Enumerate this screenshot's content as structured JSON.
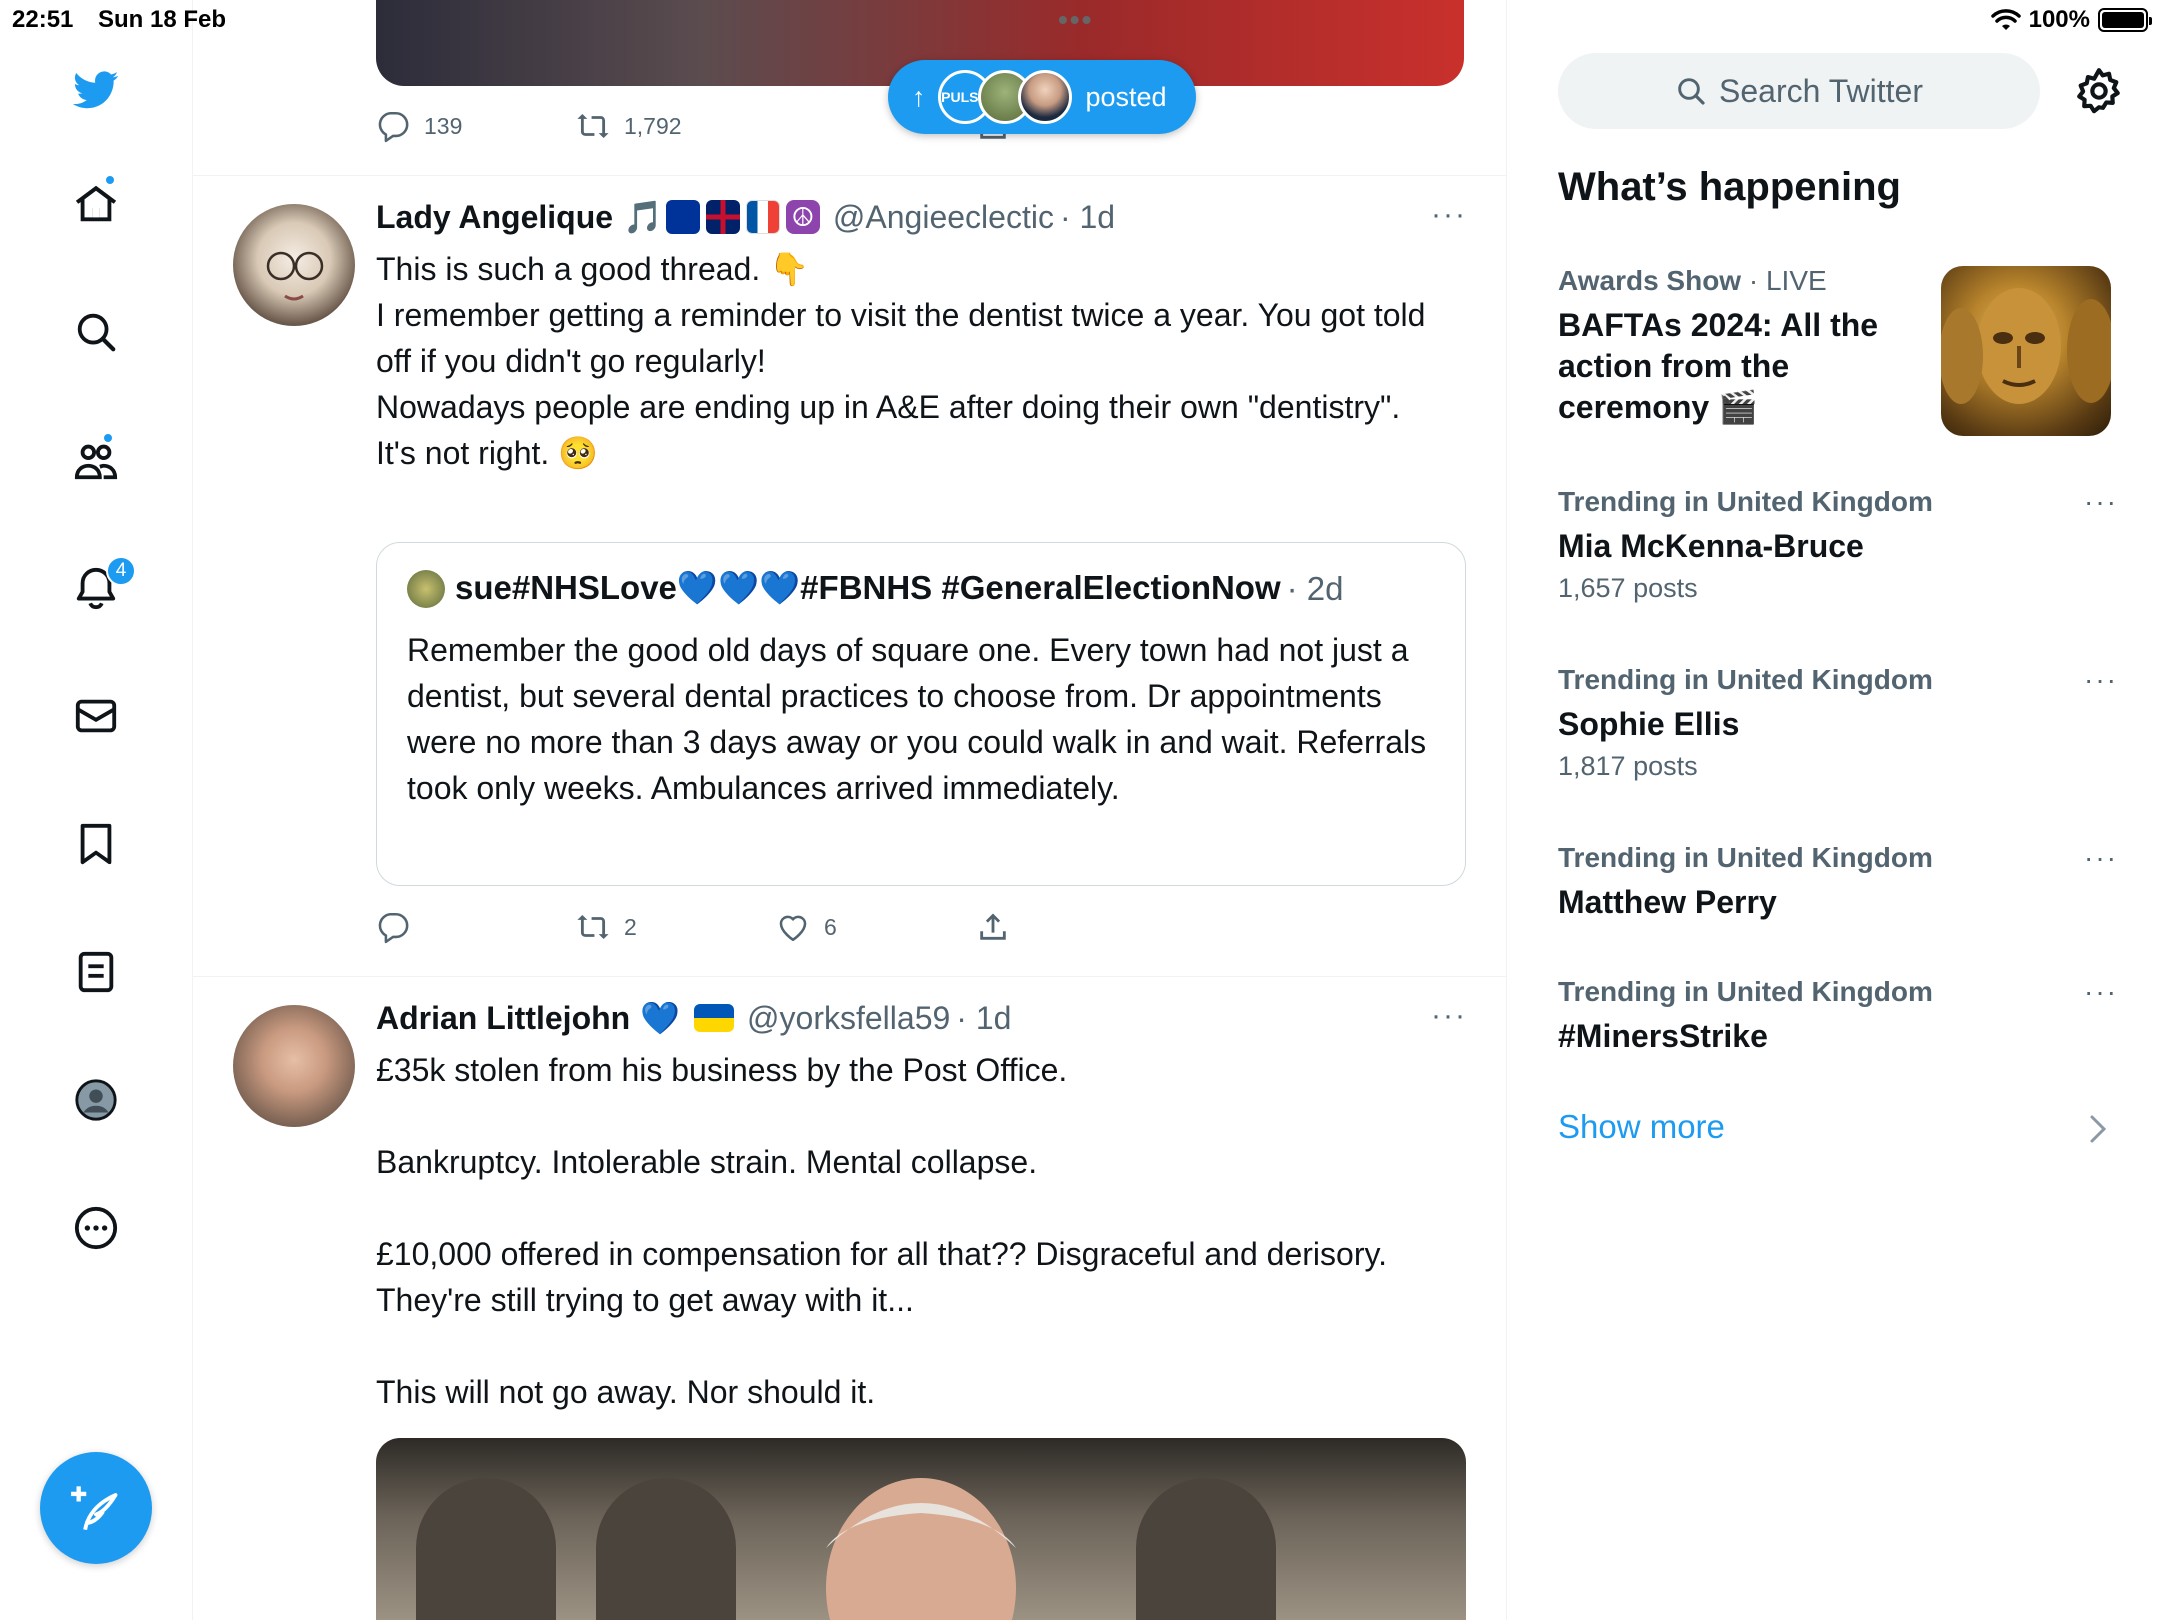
{
  "status_bar": {
    "time": "22:51",
    "date": "Sun 18 Feb",
    "battery": "100%",
    "dots": "•••"
  },
  "nav": {
    "notifications_badge": "4"
  },
  "top_tweet": {
    "replies": "139",
    "retweets": "1,792"
  },
  "new_posts_pill": {
    "label": "posted",
    "arrow": "↑",
    "avatar1_text": "PULSE"
  },
  "tweets": [
    {
      "name": "Lady Angelique",
      "name_suffix": "🎵",
      "handle": "@Angieeclectic",
      "time": "· 1d",
      "more": "···",
      "body": "This is such a good thread. 👇\nI remember getting a reminder to visit the dentist twice a year. You got told off if you didn't go regularly!\nNowadays people are ending up in A&E after doing their own \"dentistry\".\nIt's not right. 🥺",
      "quote": {
        "name": "sue#NHSLove💙💙💙#FBNHS #GeneralElectionNow",
        "time": "· 2d",
        "body": "Remember the good old days of square one. Every town had not just a dentist, but several dental practices to choose from. Dr appointments were no more than 3 days away or you could walk in and wait. Referrals took only weeks. Ambulances arrived immediately."
      },
      "retweets": "2",
      "likes": "6"
    },
    {
      "name": "Adrian Littlejohn",
      "name_suffix": "💙",
      "handle": "@yorksfella59",
      "time": "· 1d",
      "more": "···",
      "body": "£35k stolen from his business by the Post Office.\n\nBankruptcy. Intolerable strain. Mental collapse.\n\n£10,000 offered in compensation for all that?? Disgraceful and derisory. They're still trying to get away with it...\n\nThis will not go away. Nor should it."
    }
  ],
  "sidebar": {
    "search_placeholder": "Search Twitter",
    "heading": "What’s happening",
    "featured": {
      "category": "Awards Show",
      "status": " · LIVE",
      "title": "BAFTAs 2024: All the action from the ceremony 🎬"
    },
    "trends": [
      {
        "meta": "Trending in United Kingdom",
        "title": "Mia McKenna-Bruce",
        "count": "1,657 posts"
      },
      {
        "meta": "Trending in United Kingdom",
        "title": "Sophie Ellis",
        "count": "1,817 posts"
      },
      {
        "meta": "Trending in United Kingdom",
        "title": "Matthew Perry",
        "count": ""
      },
      {
        "meta": "Trending in United Kingdom",
        "title": "#MinersStrike",
        "count": ""
      }
    ],
    "trend_more": "···",
    "show_more": "Show more"
  },
  "colors": {
    "accent": "#1d9bf0",
    "text": "#0f1419",
    "muted": "#536471",
    "border": "#eff3f4"
  },
  "icons": [
    "twitter-logo-icon",
    "home-icon",
    "search-icon",
    "communities-icon",
    "bell-icon",
    "mail-icon",
    "bookmark-icon",
    "lists-icon",
    "profile-icon",
    "more-icon",
    "compose-icon",
    "reply-icon",
    "retweet-icon",
    "like-icon",
    "share-icon",
    "gear-icon",
    "chevron-right-icon"
  ]
}
